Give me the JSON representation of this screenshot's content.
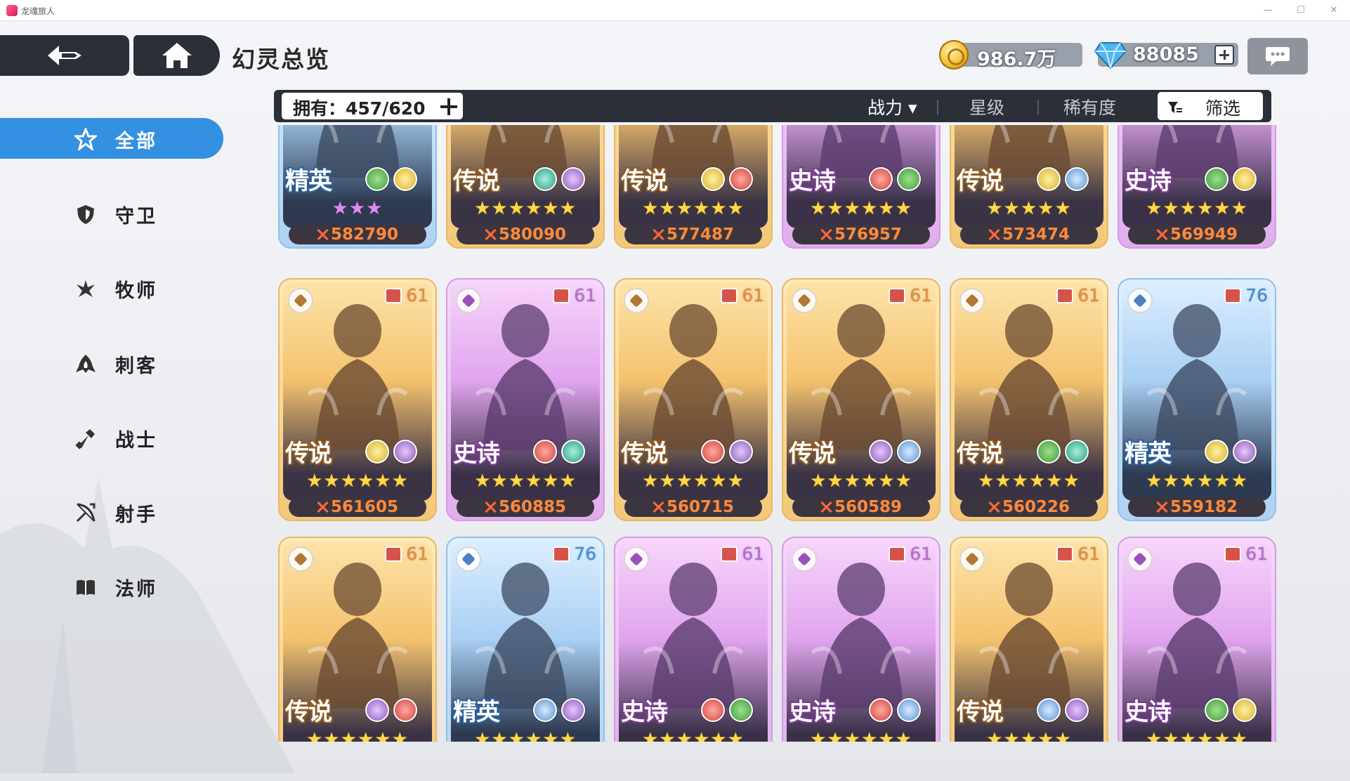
{
  "window": {
    "title": "龙魂旅人",
    "min": "—",
    "max": "☐",
    "close": "✕"
  },
  "header": {
    "title": "幻灵总览"
  },
  "resources": {
    "gold": "986.7万",
    "gems": "88085"
  },
  "filter": {
    "owned": "拥有：457/620",
    "sort_options": [
      "战力 ▾",
      "星级",
      "稀有度"
    ],
    "screen_label": "筛选"
  },
  "sidebar": {
    "items": [
      {
        "label": "全部",
        "icon": "all-icon",
        "active": true
      },
      {
        "label": "守卫",
        "icon": "shield-icon",
        "active": false
      },
      {
        "label": "牧师",
        "icon": "priest-icon",
        "active": false
      },
      {
        "label": "刺客",
        "icon": "assassin-icon",
        "active": false
      },
      {
        "label": "战士",
        "icon": "warrior-icon",
        "active": false
      },
      {
        "label": "射手",
        "icon": "archer-icon",
        "active": false
      },
      {
        "label": "法师",
        "icon": "mage-icon",
        "active": false
      }
    ]
  },
  "cards": [
    {
      "rarity": "精英",
      "tier": "blue",
      "stars": "★★★",
      "star_color": "pink",
      "level": "",
      "elements": [
        "wind",
        "light"
      ],
      "power": "582790"
    },
    {
      "rarity": "传说",
      "tier": "gold",
      "stars": "★★★★★★",
      "star_color": "gold",
      "level": "",
      "elements": [
        "water",
        "dark"
      ],
      "power": "580090"
    },
    {
      "rarity": "传说",
      "tier": "gold",
      "stars": "★★★★★★",
      "star_color": "gold",
      "level": "",
      "elements": [
        "light",
        "fire"
      ],
      "power": "577487"
    },
    {
      "rarity": "史诗",
      "tier": "purple",
      "stars": "★★★★★★",
      "star_color": "gold",
      "level": "",
      "elements": [
        "fire",
        "wind"
      ],
      "power": "576957"
    },
    {
      "rarity": "传说",
      "tier": "gold",
      "stars": "★★★★★",
      "star_color": "gold",
      "level": "",
      "elements": [
        "light",
        "ice"
      ],
      "power": "573474"
    },
    {
      "rarity": "史诗",
      "tier": "purple",
      "stars": "★★★★★★",
      "star_color": "gold",
      "level": "",
      "elements": [
        "wind",
        "light"
      ],
      "power": "569949"
    },
    {
      "rarity": "传说",
      "tier": "gold",
      "stars": "★★★★★★",
      "star_color": "gold",
      "level": "61",
      "elements": [
        "light",
        "dark"
      ],
      "power": "561605"
    },
    {
      "rarity": "史诗",
      "tier": "purple",
      "stars": "★★★★★★",
      "star_color": "gold",
      "level": "61",
      "elements": [
        "fire",
        "water"
      ],
      "power": "560885"
    },
    {
      "rarity": "传说",
      "tier": "gold",
      "stars": "★★★★★★",
      "star_color": "gold",
      "level": "61",
      "elements": [
        "fire",
        "dark"
      ],
      "power": "560715"
    },
    {
      "rarity": "传说",
      "tier": "gold",
      "stars": "★★★★★★",
      "star_color": "gold",
      "level": "61",
      "elements": [
        "dark",
        "ice"
      ],
      "power": "560589"
    },
    {
      "rarity": "传说",
      "tier": "gold",
      "stars": "★★★★★★",
      "star_color": "gold",
      "level": "61",
      "elements": [
        "wind",
        "water"
      ],
      "power": "560226"
    },
    {
      "rarity": "精英",
      "tier": "blue",
      "stars": "★★★★★★",
      "star_color": "gold",
      "level": "76",
      "elements": [
        "light",
        "dark"
      ],
      "power": "559182"
    },
    {
      "rarity": "传说",
      "tier": "gold",
      "stars": "★★★★★★",
      "star_color": "gold",
      "level": "61",
      "elements": [
        "dark",
        "fire"
      ],
      "power": ""
    },
    {
      "rarity": "精英",
      "tier": "blue",
      "stars": "★★★★★★",
      "star_color": "gold",
      "level": "76",
      "elements": [
        "ice",
        "dark"
      ],
      "power": ""
    },
    {
      "rarity": "史诗",
      "tier": "purple",
      "stars": "★★★★★★",
      "star_color": "gold",
      "level": "61",
      "elements": [
        "fire",
        "wind"
      ],
      "power": ""
    },
    {
      "rarity": "史诗",
      "tier": "purple",
      "stars": "★★★★★★",
      "star_color": "gold",
      "level": "61",
      "elements": [
        "fire",
        "ice"
      ],
      "power": ""
    },
    {
      "rarity": "传说",
      "tier": "gold",
      "stars": "★★★★★",
      "star_color": "gold",
      "level": "61",
      "elements": [
        "ice",
        "dark"
      ],
      "power": ""
    },
    {
      "rarity": "史诗",
      "tier": "purple",
      "stars": "★★★★★★",
      "star_color": "gold",
      "level": "61",
      "elements": [
        "wind",
        "light"
      ],
      "power": ""
    }
  ]
}
